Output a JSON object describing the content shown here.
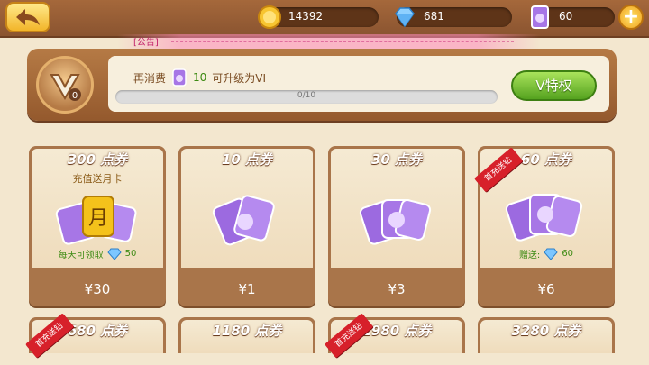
{
  "topbar": {
    "gold": "14392",
    "diamonds": "681",
    "tickets": "60"
  },
  "announcement": {
    "tag": "[公告]"
  },
  "vip": {
    "prefix": "再消费",
    "amount": "10",
    "suffix": "可升级为VI",
    "progress_text": "0/10",
    "progress_fraction": 0.0,
    "button_label": "V特权"
  },
  "cards": [
    {
      "title": "300 点券",
      "price": "¥30",
      "subtitle": "充值送月卡",
      "note": "每天可领取",
      "note_value": "50",
      "month_glyph": "月",
      "ribbon": ""
    },
    {
      "title": "10 点券",
      "price": "¥1",
      "ribbon": ""
    },
    {
      "title": "30 点券",
      "price": "¥3",
      "ribbon": ""
    },
    {
      "title": "60 点券",
      "price": "¥6",
      "note": "赠送:",
      "note_value": "60",
      "ribbon": "首充送钻"
    }
  ],
  "cards_row2": [
    {
      "title": "680 点券",
      "ribbon": "首充送钻"
    },
    {
      "title": "1180 点券",
      "ribbon": ""
    },
    {
      "title": "1980 点券",
      "ribbon": "首充送钻"
    },
    {
      "title": "3280 点券",
      "ribbon": ""
    }
  ],
  "colors": {
    "wood": "#a9754a",
    "cream": "#f5ead3",
    "green": "#7bc33b",
    "ribbon_red": "#d7202a"
  }
}
